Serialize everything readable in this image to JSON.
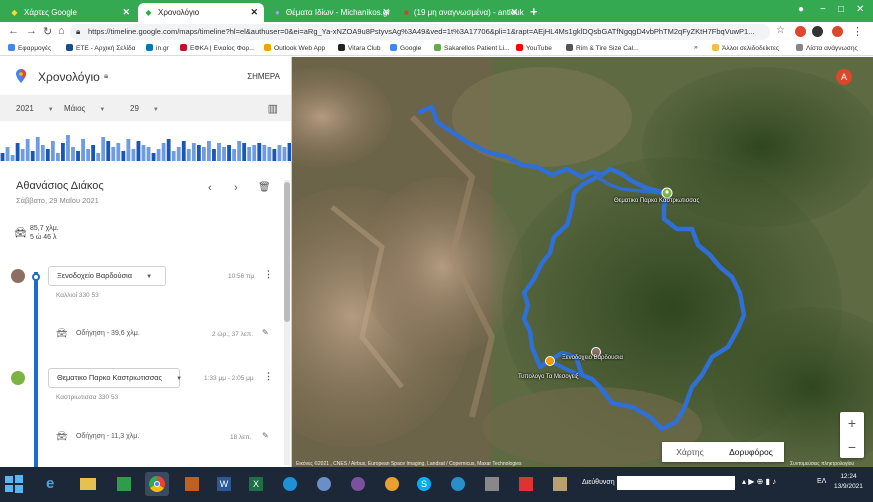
{
  "browser": {
    "tabs": [
      {
        "title": "Χάρτες Google",
        "active": false
      },
      {
        "title": "Χρονολόγιο",
        "active": true
      },
      {
        "title": "Θέματα Ιδίων - Michanikos.gr",
        "active": false
      },
      {
        "title": "(19 μη αναγνωσμένα) - antlouk",
        "active": false
      }
    ],
    "new_tab": "+",
    "url": "https://timeline.google.com/maps/timeline?hl=el&authuser=0&ei=aRg_Ya-xNZOA9u8PstyvsAg%3A49&ved=1t%3A17706&pli=1&rapt=AEjHL4Ms1gklDQsbGATfNgqgD4vbPhTM2qFyZKtH7FbqVuwP1...",
    "bookmarks": [
      {
        "label": "Εφαρμογές",
        "color": "#4285f4"
      },
      {
        "label": "ΕΤΕ - Αρχική Σελίδα",
        "color": "#1a4b8c"
      },
      {
        "label": "in.gr",
        "color": "#0077b5"
      },
      {
        "label": "ΕΦΚΑ | Ενιαίος Φορ...",
        "color": "#c8102e"
      },
      {
        "label": "Outlook Web App",
        "color": "#f4a100"
      },
      {
        "label": "Vitara Club",
        "color": "#222222"
      },
      {
        "label": "Google",
        "color": "#4285f4"
      },
      {
        "label": "Sakarellos Patient Li...",
        "color": "#6aa84f"
      },
      {
        "label": "YouTube",
        "color": "#ff0000"
      },
      {
        "label": "Rim & Tire Size Cal...",
        "color": "#555555"
      }
    ],
    "bookmarks_more": "»",
    "other_bookmarks": "Άλλοι σελιδοδείκτες",
    "reading_list": "Λίστα ανάγνωσης"
  },
  "panel": {
    "title": "Χρονολόγιο",
    "today": "ΣΗΜΕΡΑ",
    "year": "2021",
    "month": "Μάιος",
    "day": "29",
    "histogram": [
      0.2,
      0.35,
      0.15,
      0.45,
      0.3,
      0.55,
      0.25,
      0.6,
      0.4,
      0.3,
      0.5,
      0.2,
      0.45,
      0.65,
      0.35,
      0.25,
      0.55,
      0.3,
      0.4,
      0.2,
      0.6,
      0.5,
      0.35,
      0.45,
      0.25,
      0.55,
      0.3,
      0.5,
      0.4,
      0.35,
      0.2,
      0.3,
      0.45,
      0.55,
      0.25,
      0.35,
      0.5,
      0.3,
      0.45,
      0.4,
      0.35,
      0.5,
      0.3,
      0.45,
      0.35,
      0.4,
      0.3,
      0.5,
      0.45,
      0.35,
      0.4,
      0.45,
      0.4,
      0.35,
      0.3,
      0.4,
      0.35,
      0.45
    ],
    "day_heading": "Αθανάσιος Διάκος",
    "day_date": "Σάββατο, 29 Μαΐου 2021",
    "summary_distance": "85,7 χλμ.",
    "summary_time": "5 ώ 46 λ",
    "entries": [
      {
        "place": "Ξενοδοχείο Βαρδούσια",
        "time": "10:56 πμ",
        "sub": "Καλλιοί 330 53"
      },
      {
        "drive": "Οδήγηση - 39,6 χλμ.",
        "duration": "2 ώρ., 37 λεπ."
      },
      {
        "place": "Θεματικο Παρκο Καστριωτισσας",
        "time": "1:33 μμ - 2:05 μμ",
        "sub": "Καστριωτισσα 330 53"
      },
      {
        "drive": "Οδήγηση - 11,3 χλμ.",
        "duration": "18 λεπ."
      }
    ]
  },
  "map": {
    "labels": {
      "park": "Θεματικο Παρκο Καστριωτισσας",
      "hotel": "Ξενοδοχειο Βαρδουσια",
      "center": "Τυπολογο Τα Μεσογειξ"
    },
    "map_type_map": "Χάρτης",
    "map_type_sat": "Δορυφόρος",
    "zoom_in": "+",
    "zoom_out": "−",
    "attribution": "Εικόνες ©2021 , CNES / Airbus, European Space Imaging, Landsat / Copernicus, Maxar Technologies",
    "terms": "Συντομεύσεις πληκτρολογίου",
    "avatar": "A",
    "route_color": "#2f6fd6"
  },
  "taskbar": {
    "address_label": "Διεύθυνση",
    "language": "ΕΛ",
    "time": "12:24",
    "date": "13/9/2021"
  }
}
